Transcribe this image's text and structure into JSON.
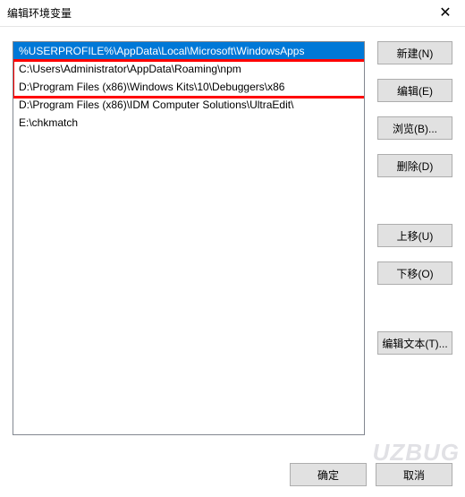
{
  "window": {
    "title": "编辑环境变量"
  },
  "list": {
    "items": [
      "%USERPROFILE%\\AppData\\Local\\Microsoft\\WindowsApps",
      "C:\\Users\\Administrator\\AppData\\Roaming\\npm",
      "D:\\Program Files (x86)\\Windows Kits\\10\\Debuggers\\x86",
      "D:\\Program Files (x86)\\IDM Computer Solutions\\UltraEdit\\",
      "E:\\chkmatch"
    ],
    "selected_index": 0,
    "highlight_box": {
      "from_index": 1,
      "to_index": 2
    }
  },
  "buttons": {
    "new": "新建(N)",
    "edit": "编辑(E)",
    "browse": "浏览(B)...",
    "delete": "删除(D)",
    "move_up": "上移(U)",
    "move_down": "下移(O)",
    "edit_text": "编辑文本(T)...",
    "ok": "确定",
    "cancel": "取消"
  },
  "watermark": "UZBUG"
}
